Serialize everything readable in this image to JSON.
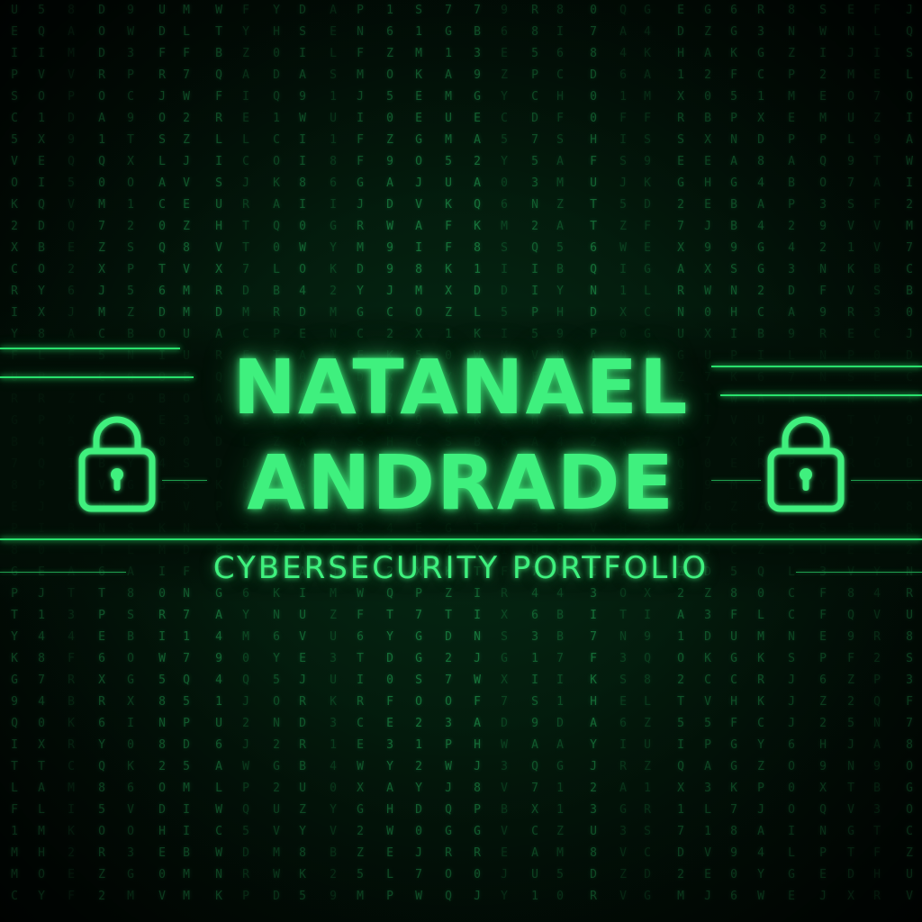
{
  "title": {
    "line1": "NATANAEL",
    "line2": "ANDRADE"
  },
  "subtitle": "CYBERSECURITY PORTFOLIO",
  "icons": {
    "left": "padlock-icon",
    "right": "padlock-icon"
  },
  "colors": {
    "accent": "#3ff07e",
    "background": "#031a0c"
  }
}
